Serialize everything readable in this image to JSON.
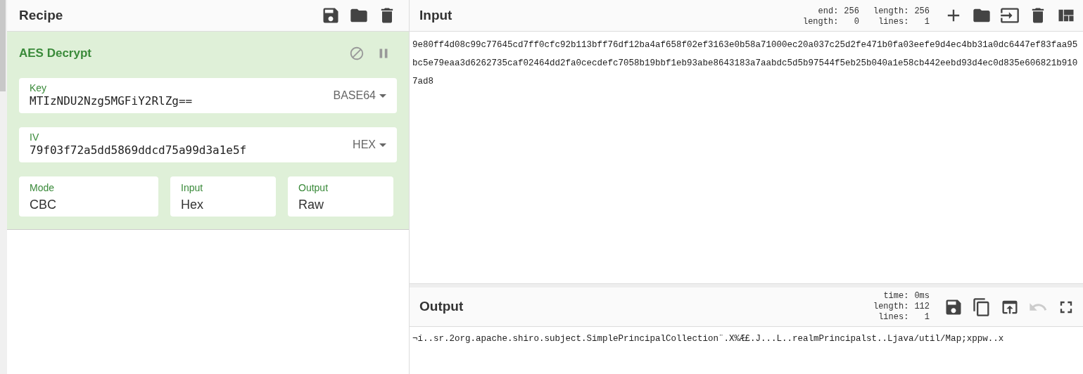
{
  "recipe": {
    "title": "Recipe",
    "operation": {
      "name": "AES Decrypt",
      "disabled": false,
      "paused": false,
      "args": [
        {
          "kind": "wide",
          "label": "Key",
          "value": "MTIzNDU2Nzg5MGFiY2RlZg==",
          "format": "BASE64"
        },
        {
          "kind": "wide",
          "label": "IV",
          "value": "79f03f72a5dd5869ddcd75a99d3a1e5f",
          "format": "HEX"
        }
      ],
      "options": [
        {
          "label": "Mode",
          "value": "CBC"
        },
        {
          "label": "Input",
          "value": "Hex"
        },
        {
          "label": "Output",
          "value": "Raw"
        }
      ]
    }
  },
  "input": {
    "title": "Input",
    "stats_left": [
      {
        "label": "end:",
        "value": "256"
      },
      {
        "label": "length:",
        "value": "0"
      }
    ],
    "stats_right": [
      {
        "label": "length:",
        "value": "256"
      },
      {
        "label": "lines:",
        "value": "1"
      }
    ],
    "text": "9e80ff4d08c99c77645cd7ff0cfc92b113bff76df12ba4af658f02ef3163e0b58a71000ec20a037c25d2fe471b0fa03eefe9d4ec4bb31a0dc6447ef83faa95bc5e79eaa3d6262735caf02464dd2fa0cecdefc7058b19bbf1eb93abe8643183a7aabdc5d5b97544f5eb25b040a1e58cb442eebd93d4ec0d835e606821b9107ad8"
  },
  "output": {
    "title": "Output",
    "stats": [
      {
        "label": "time:",
        "value": "0ms"
      },
      {
        "label": "length:",
        "value": "112"
      },
      {
        "label": "lines:",
        "value": "1"
      }
    ],
    "undo_disabled": true,
    "text": "¬í..sr.2org.apache.shiro.subject.SimplePrincipalCollection¨.X%Æ£.J...L..realmPrincipalst..Ljava/util/Map;xppw..x"
  }
}
